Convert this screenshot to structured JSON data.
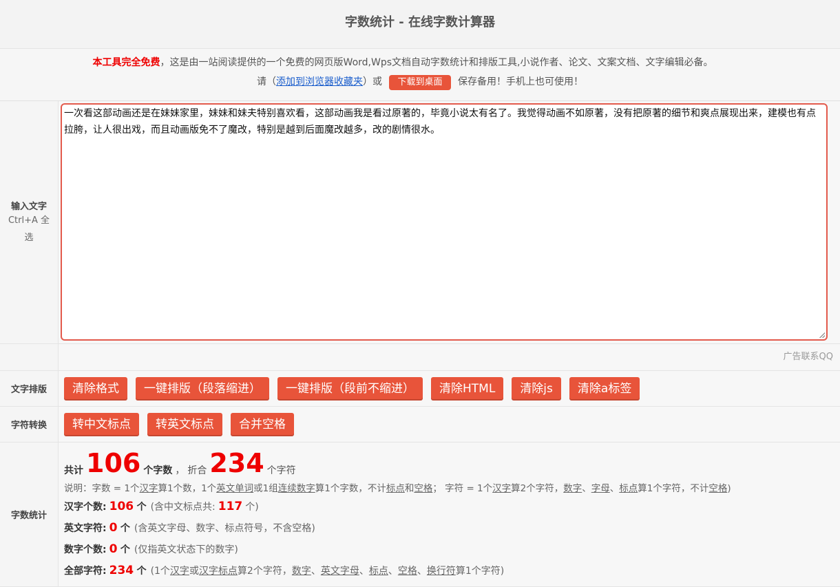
{
  "header": {
    "title": "字数统计 - 在线字数计算器"
  },
  "intro": {
    "free_label": "本工具完全免费",
    "desc": "，这是由一站阅读提供的一个免费的网页版Word,Wps文档自动字数统计和排版工具,小说作者、论文、文案文档、文字编辑必备。",
    "please": "请（",
    "bookmark_link": "添加到浏览器收藏夹",
    "or": "）或",
    "download_button": "下载到桌面",
    "after": "保存备用！手机上也可使用！"
  },
  "input": {
    "label": "输入文字",
    "hint": "Ctrl+A 全选",
    "text": "一次看这部动画还是在妹妹家里，妹妹和妹夫特别喜欢看，这部动画我是看过原著的，毕竟小说太有名了。我觉得动画不如原著，没有把原著的细节和爽点展现出来，建模也有点拉胯，让人很出戏，而且动画版免不了魔改，特别是越到后面魔改越多，改的剧情很水。"
  },
  "ad": {
    "text": "广告联系QQ"
  },
  "format": {
    "label": "文字排版",
    "buttons": [
      "清除格式",
      "一键排版（段落缩进）",
      "一键排版（段前不缩进）",
      "清除HTML",
      "清除js",
      "清除a标签"
    ]
  },
  "convert": {
    "label": "字符转换",
    "buttons": [
      "转中文标点",
      "转英文标点",
      "合并空格"
    ]
  },
  "stats": {
    "label": "字数统计",
    "total_prefix": "共计",
    "word_count": "106",
    "word_unit": "个字数",
    "comma": "，",
    "equiv": "折合",
    "char_count": "234",
    "char_unit": "个字符",
    "note": {
      "p1": "说明：字数 = 1个",
      "u1": "汉字",
      "p2": "算1个数，1个",
      "u2": "英文单词",
      "p3": "或1组",
      "u3": "连续数字",
      "p4": "算1个字数，不计",
      "u4": "标点",
      "p5": "和",
      "u5": "空格",
      "p6": "；  字符 = 1个",
      "u6": "汉字",
      "p7": "算2个字符，",
      "u7": "数字",
      "p8": "、",
      "u8": "字母",
      "p9": "、",
      "u9": "标点",
      "p10": "算1个字符，不计",
      "u10": "空格",
      "p11": ")"
    },
    "hanzi": {
      "label": "汉字个数:",
      "value": "106",
      "unit": "个",
      "extra_pre": "(含中文标点共:",
      "extra_value": "117",
      "extra_post": "个)"
    },
    "english": {
      "label": "英文字符:",
      "value": "0",
      "unit": "个",
      "extra": "(含英文字母、数字、标点符号，不含空格)"
    },
    "digits": {
      "label": "数字个数:",
      "value": "0",
      "unit": "个",
      "extra": "(仅指英文状态下的数字)"
    },
    "all": {
      "label": "全部字符:",
      "value": "234",
      "unit": "个",
      "p1": "(1个",
      "u1": "汉字",
      "p2": "或",
      "u2": "汉字标点",
      "p3": "算2个字符，",
      "u3": "数字",
      "p4": "、",
      "u4": "英文字母",
      "p5": "、",
      "u5": "标点",
      "p6": "、",
      "u6": "空格",
      "p7": "、",
      "u7": "换行符",
      "p8": "算1个字符)"
    }
  },
  "colors": {
    "accent": "#e8543a",
    "highlight": "#ee0000",
    "link": "#1a5dcc"
  }
}
